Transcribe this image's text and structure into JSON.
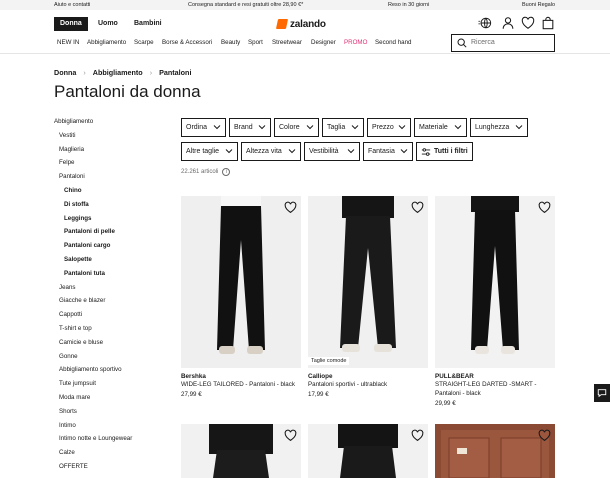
{
  "topbar": {
    "help": "Aiuto e contatti",
    "shipping": "Consegna standard e resi gratuiti oltre 28,90 €*",
    "returns": "Reso in 30 giorni",
    "gift": "Buoni Regalo"
  },
  "header": {
    "genders": [
      "Donna",
      "Uomo",
      "Bambini"
    ],
    "logo": "zalando",
    "nav": [
      "NEW IN",
      "Abbigliamento",
      "Scarpe",
      "Borse & Accessori",
      "Beauty",
      "Sport",
      "Streetwear",
      "Designer",
      "PROMO",
      "Second hand"
    ],
    "search_placeholder": "Ricerca"
  },
  "breadcrumb": [
    "Donna",
    "Abbigliamento",
    "Pantaloni"
  ],
  "page_title": "Pantaloni da donna",
  "sidebar": {
    "items": [
      "Abbigliamento",
      "Vestiti",
      "Maglieria",
      "Felpe",
      "Pantaloni",
      "Chino",
      "Di stoffa",
      "Leggings",
      "Pantaloni di pelle",
      "Pantaloni cargo",
      "Salopette",
      "Pantaloni tuta",
      "Jeans",
      "Giacche e blazer",
      "Cappotti",
      "T-shirt e top",
      "Camicie e bluse",
      "Gonne",
      "Abbigliamento sportivo",
      "Tute jumpsuit",
      "Moda mare",
      "Shorts",
      "Intimo",
      "Intimo notte e Loungewear",
      "Calze",
      "OFFERTE"
    ]
  },
  "filters": {
    "row1": [
      "Ordina",
      "Brand",
      "Colore",
      "Taglia",
      "Prezzo",
      "Materiale",
      "Lunghezza"
    ],
    "row2": [
      "Altre taglie",
      "Altezza vita",
      "Vestibilità",
      "Fantasia"
    ],
    "all_filters": "Tutti i filtri"
  },
  "results_count": "22.261 articoli",
  "products": [
    {
      "brand": "Bershka",
      "name": "WIDE-LEG TAILORED - Pantaloni - black",
      "price": "27,99 €",
      "tag": ""
    },
    {
      "brand": "Calliope",
      "name": "Pantaloni sportivi - ultrablack",
      "price": "17,99 €",
      "tag": "Taglie comode"
    },
    {
      "brand": "PULL&BEAR",
      "name": "STRAIGHT-LEG DARTED -SMART - Pantaloni - black",
      "price": "29,99 €",
      "tag": ""
    }
  ],
  "colors": {
    "accent": "#ff6900",
    "promo": "#e02f75",
    "text": "#1a1a1a"
  }
}
